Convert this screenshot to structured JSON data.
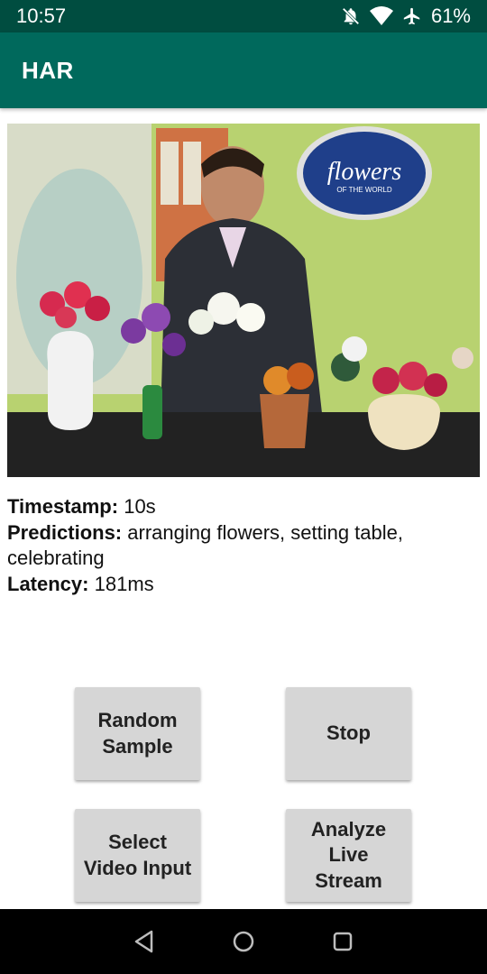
{
  "status_bar": {
    "time": "10:57",
    "battery": "61%",
    "icons": [
      "notifications-off-icon",
      "wifi-icon",
      "airplane-icon"
    ]
  },
  "app_bar": {
    "title": "HAR"
  },
  "video": {
    "description_icon": "video-frame-image"
  },
  "info": {
    "timestamp_label": "Timestamp:",
    "timestamp_value": "10s",
    "predictions_label": "Predictions:",
    "predictions_value": "arranging flowers, setting table, celebrating",
    "latency_label": "Latency:",
    "latency_value": "181ms"
  },
  "buttons": {
    "random_sample": "Random Sample",
    "stop": "Stop",
    "select_video_input": "Select Video Input",
    "analyze_live_stream": "Analyze Live Stream"
  },
  "nav": {
    "icons": [
      "back-icon",
      "home-icon",
      "recents-icon"
    ]
  },
  "colors": {
    "status_bar": "#004d40",
    "app_bar": "#00695c",
    "button": "#d6d6d6"
  }
}
